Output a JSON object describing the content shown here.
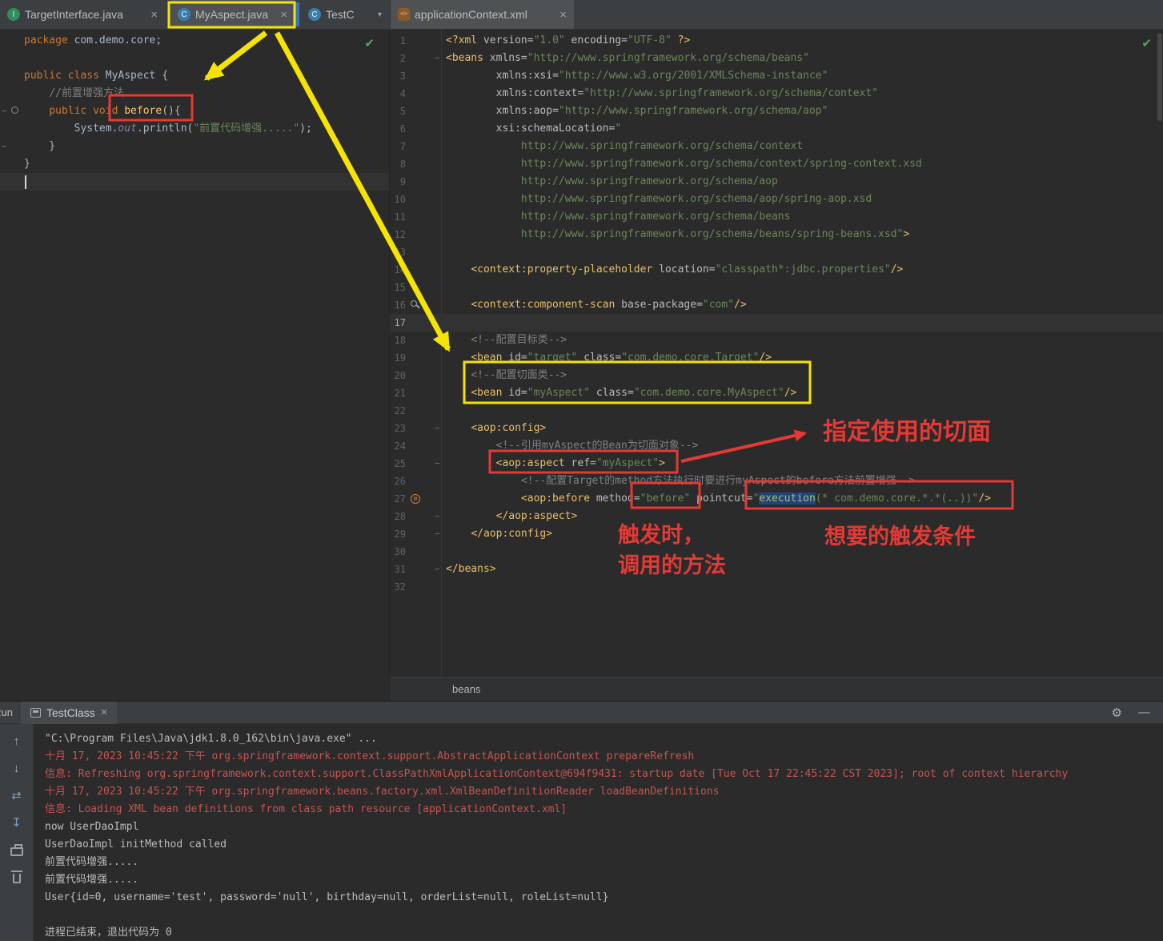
{
  "colors": {
    "annotation_red": "#e53935",
    "annotation_yellow": "#f5e400",
    "editor_background": "#2b2b2b",
    "panel_background": "#3c3f41"
  },
  "icons": {
    "close": "×",
    "chevron_down": "▾",
    "gear": "⚙",
    "minimize": "—",
    "check": "✔",
    "arrow_up": "↑",
    "arrow_down": "↓",
    "soft_wrap": "⇄",
    "scroll_end": "↧",
    "advice_marker": "m"
  },
  "tabbar": {
    "left_tabs": [
      {
        "label": "TargetInterface.java",
        "letter": "I",
        "type": "interface",
        "selected": false,
        "has_close": true
      },
      {
        "label": "MyAspect.java",
        "letter": "C",
        "type": "class",
        "selected": true,
        "has_close": true
      },
      {
        "label": "TestC",
        "letter": "C",
        "type": "class",
        "selected": false,
        "has_chevron": true
      }
    ],
    "right_tabs": [
      {
        "label": "applicationContext.xml",
        "letter": "</>",
        "type": "xml",
        "selected": true,
        "has_close": true
      }
    ]
  },
  "java_editor": {
    "lines": [
      {
        "seg": [
          [
            "k",
            "package "
          ],
          [
            "p",
            "com.demo.core;"
          ]
        ]
      },
      {
        "seg": []
      },
      {
        "seg": [
          [
            "k",
            "public class "
          ],
          [
            "p",
            "MyAspect {"
          ]
        ]
      },
      {
        "seg": [
          [
            "p",
            "    "
          ],
          [
            "c",
            "//前置增强方法"
          ]
        ]
      },
      {
        "seg": [
          [
            "p",
            "    "
          ],
          [
            "k",
            "public void "
          ],
          [
            "m",
            "before"
          ],
          [
            "p",
            "(){"
          ]
        ],
        "gutter": "circle",
        "fold": "minus"
      },
      {
        "seg": [
          [
            "p",
            "        "
          ],
          [
            "p",
            "System."
          ],
          [
            "f",
            "out"
          ],
          [
            "p",
            ".println("
          ],
          [
            "s",
            "\"前置代码增强.....\""
          ],
          [
            "p",
            ");"
          ]
        ]
      },
      {
        "seg": [
          [
            "p",
            "    }"
          ]
        ],
        "fold": "end"
      },
      {
        "seg": [
          [
            "p",
            "}"
          ]
        ]
      },
      {
        "seg": [],
        "caret": true
      }
    ]
  },
  "xml_editor": {
    "breadcrumb": "beans",
    "lines": [
      {
        "seg": [
          [
            "t",
            "<?xml "
          ],
          [
            "a",
            "version="
          ],
          [
            "s",
            "\"1.0\""
          ],
          [
            "a",
            " encoding="
          ],
          [
            "s",
            "\"UTF-8\""
          ],
          [
            "t",
            " ?>"
          ]
        ]
      },
      {
        "seg": [
          [
            "t",
            "<beans "
          ],
          [
            "a",
            "xmlns="
          ],
          [
            "s",
            "\"http://www.springframework.org/schema/beans\""
          ]
        ],
        "fold": "minus"
      },
      {
        "seg": [
          [
            "p",
            "        "
          ],
          [
            "a",
            "xmlns:xsi="
          ],
          [
            "s",
            "\"http://www.w3.org/2001/XMLSchema-instance\""
          ]
        ]
      },
      {
        "seg": [
          [
            "p",
            "        "
          ],
          [
            "a",
            "xmlns:context="
          ],
          [
            "s",
            "\"http://www.springframework.org/schema/context\""
          ]
        ]
      },
      {
        "seg": [
          [
            "p",
            "        "
          ],
          [
            "a",
            "xmlns:aop="
          ],
          [
            "s",
            "\"http://www.springframework.org/schema/aop\""
          ]
        ]
      },
      {
        "seg": [
          [
            "p",
            "        "
          ],
          [
            "a",
            "xsi:schemaLocation="
          ],
          [
            "s",
            "\""
          ]
        ]
      },
      {
        "seg": [
          [
            "p",
            "            "
          ],
          [
            "s",
            "http://www.springframework.org/schema/context"
          ]
        ]
      },
      {
        "seg": [
          [
            "p",
            "            "
          ],
          [
            "s",
            "http://www.springframework.org/schema/context/spring-context.xsd"
          ]
        ]
      },
      {
        "seg": [
          [
            "p",
            "            "
          ],
          [
            "s",
            "http://www.springframework.org/schema/aop"
          ]
        ]
      },
      {
        "seg": [
          [
            "p",
            "            "
          ],
          [
            "s",
            "http://www.springframework.org/schema/aop/spring-aop.xsd"
          ]
        ]
      },
      {
        "seg": [
          [
            "p",
            "            "
          ],
          [
            "s",
            "http://www.springframework.org/schema/beans"
          ]
        ]
      },
      {
        "seg": [
          [
            "p",
            "            "
          ],
          [
            "s",
            "http://www.springframework.org/schema/beans/spring-beans.xsd\""
          ],
          [
            "t",
            ">"
          ]
        ]
      },
      {
        "seg": []
      },
      {
        "seg": [
          [
            "p",
            "    "
          ],
          [
            "t",
            "<context:property-placeholder "
          ],
          [
            "a",
            "location="
          ],
          [
            "s",
            "\"classpath*:jdbc.properties\""
          ],
          [
            "t",
            "/>"
          ]
        ]
      },
      {
        "seg": []
      },
      {
        "seg": [
          [
            "p",
            "    "
          ],
          [
            "t",
            "<context:component-scan "
          ],
          [
            "a",
            "base-package="
          ],
          [
            "s",
            "\"com\""
          ],
          [
            "t",
            "/>"
          ]
        ],
        "gutter": "magnifier"
      },
      {
        "seg": [],
        "caret": true
      },
      {
        "seg": [
          [
            "p",
            "    "
          ],
          [
            "c",
            "<!--配置目标类-->"
          ]
        ]
      },
      {
        "seg": [
          [
            "p",
            "    "
          ],
          [
            "t",
            "<bean "
          ],
          [
            "a",
            "id="
          ],
          [
            "s",
            "\"target\""
          ],
          [
            "a",
            " class="
          ],
          [
            "s",
            "\"com.demo.core.Target\""
          ],
          [
            "t",
            "/>"
          ]
        ]
      },
      {
        "seg": [
          [
            "p",
            "    "
          ],
          [
            "c",
            "<!--配置切面类-->"
          ]
        ]
      },
      {
        "seg": [
          [
            "p",
            "    "
          ],
          [
            "t",
            "<bean "
          ],
          [
            "a",
            "id="
          ],
          [
            "s",
            "\"myAspect\""
          ],
          [
            "a",
            " class="
          ],
          [
            "s",
            "\"com.demo.core.MyAspect\""
          ],
          [
            "t",
            "/>"
          ]
        ]
      },
      {
        "seg": []
      },
      {
        "seg": [
          [
            "p",
            "    "
          ],
          [
            "t",
            "<aop:config>"
          ]
        ],
        "fold": "minus"
      },
      {
        "seg": [
          [
            "p",
            "        "
          ],
          [
            "c",
            "<!--引用myAspect的Bean为切面对象-->"
          ]
        ]
      },
      {
        "seg": [
          [
            "p",
            "        "
          ],
          [
            "t",
            "<aop:aspect "
          ],
          [
            "a",
            "ref="
          ],
          [
            "s",
            "\"myAspect\""
          ],
          [
            "t",
            ">"
          ]
        ],
        "fold": "minus"
      },
      {
        "seg": [
          [
            "p",
            "            "
          ],
          [
            "c",
            "<!--配置Target的method方法执行时要进行myAspect的before方法前置增强-->"
          ]
        ]
      },
      {
        "seg": [
          [
            "p",
            "            "
          ],
          [
            "t",
            "<aop:before "
          ],
          [
            "a",
            "method="
          ],
          [
            "s",
            "\"before\""
          ],
          [
            "a",
            " pointcut="
          ],
          [
            "s",
            "\""
          ],
          [
            "hl",
            "execution"
          ],
          [
            "s",
            "(* com.demo.core.*.*(..))\""
          ],
          [
            "t",
            "/>"
          ]
        ],
        "gutter": "advice"
      },
      {
        "seg": [
          [
            "p",
            "        "
          ],
          [
            "t",
            "</aop:aspect>"
          ]
        ],
        "fold": "end"
      },
      {
        "seg": [
          [
            "p",
            "    "
          ],
          [
            "t",
            "</aop:config>"
          ]
        ],
        "fold": "end"
      },
      {
        "seg": []
      },
      {
        "seg": [
          [
            "t",
            "</beans>"
          ]
        ],
        "fold": "end"
      },
      {
        "seg": []
      }
    ]
  },
  "console": {
    "panel_label": "Run:",
    "tab_label": "TestClass",
    "toolbar": [
      {
        "name": "prev-occurrence-icon",
        "glyph": "arrow_up"
      },
      {
        "name": "next-occurrence-icon",
        "glyph": "arrow_down"
      },
      {
        "name": "soft-wrap-icon",
        "glyph": "soft_wrap",
        "blue": true
      },
      {
        "name": "scroll-to-end-icon",
        "glyph": "scroll_end",
        "blue": true
      },
      {
        "name": "print-icon",
        "css": "css-printer"
      },
      {
        "name": "clear-all-icon",
        "css": "css-trash"
      }
    ],
    "lines": [
      {
        "c": "plain",
        "t": "\"C:\\Program Files\\Java\\jdk1.8.0_162\\bin\\java.exe\" ..."
      },
      {
        "c": "err",
        "t": "十月 17, 2023 10:45:22 下午 org.springframework.context.support.AbstractApplicationContext prepareRefresh"
      },
      {
        "c": "err",
        "t": "信息: Refreshing org.springframework.context.support.ClassPathXmlApplicationContext@694f9431: startup date [Tue Oct 17 22:45:22 CST 2023]; root of context hierarchy"
      },
      {
        "c": "err",
        "t": "十月 17, 2023 10:45:22 下午 org.springframework.beans.factory.xml.XmlBeanDefinitionReader loadBeanDefinitions"
      },
      {
        "c": "err",
        "t": "信息: Loading XML bean definitions from class path resource [applicationContext.xml]"
      },
      {
        "c": "plain",
        "t": "now UserDaoImpl"
      },
      {
        "c": "plain",
        "t": "UserDaoImpl initMethod called"
      },
      {
        "c": "plain",
        "t": "前置代码增强....."
      },
      {
        "c": "plain",
        "t": "前置代码增强....."
      },
      {
        "c": "plain",
        "t": "User{id=0, username='test', password='null', birthday=null, orderList=null, roleList=null}"
      },
      {
        "c": "plain",
        "t": ""
      },
      {
        "c": "plain",
        "t": "进程已结束，退出代码为 0"
      }
    ]
  },
  "annotations": {
    "aspect_pointer_label": "指定使用的切面",
    "trigger_line1": "触发时，",
    "trigger_line2": "调用的方法",
    "condition_label": "想要的触发条件"
  }
}
